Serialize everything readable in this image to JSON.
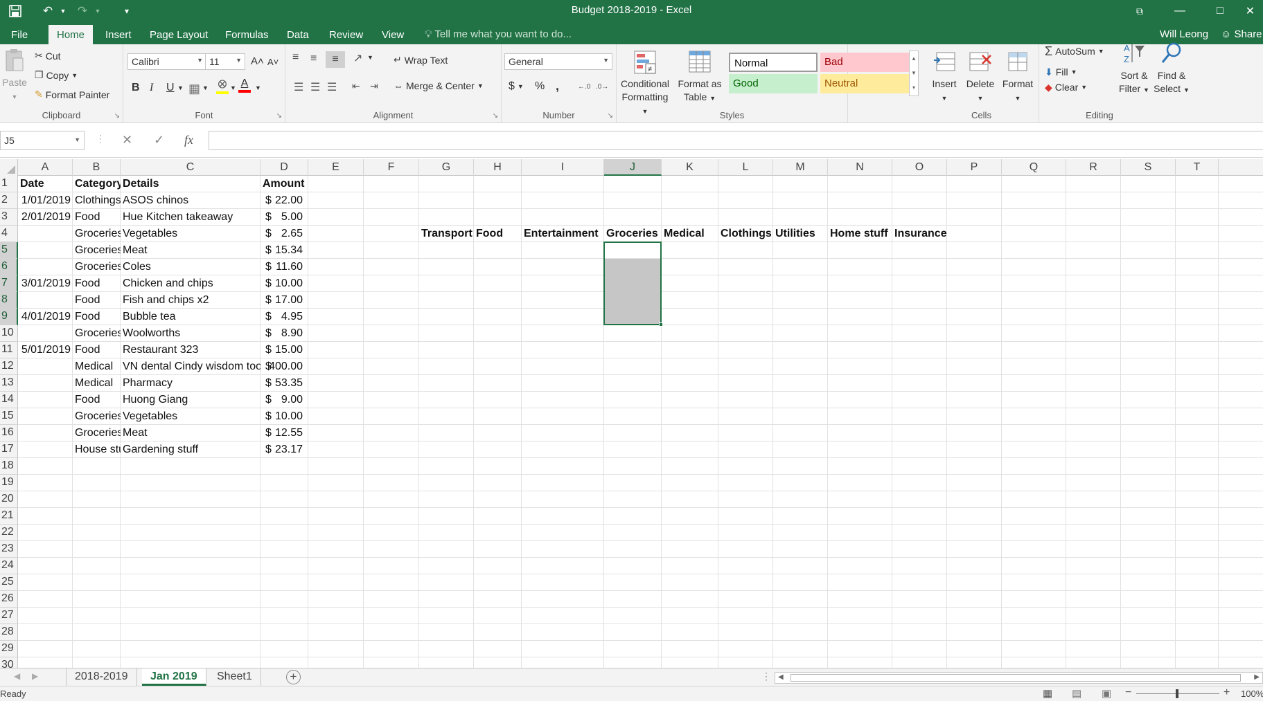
{
  "title": "Budget 2018-2019 - Excel",
  "quick_access": {
    "save_icon": "save-icon",
    "undo_icon": "undo-icon",
    "redo_icon": "redo-icon"
  },
  "tabs": [
    "File",
    "Home",
    "Insert",
    "Page Layout",
    "Formulas",
    "Data",
    "Review",
    "View"
  ],
  "active_tab": "Home",
  "tell_me": "Tell me what you want to do...",
  "user": "Will Leong",
  "share": "Share",
  "ribbon": {
    "clipboard": {
      "label": "Clipboard",
      "paste": "Paste",
      "cut": "Cut",
      "copy": "Copy",
      "format_painter": "Format Painter"
    },
    "font": {
      "label": "Font",
      "font_name": "Calibri",
      "font_size": "11",
      "bold": "B",
      "italic": "I",
      "underline": "U"
    },
    "alignment": {
      "label": "Alignment",
      "wrap_text": "Wrap Text",
      "merge_center": "Merge & Center"
    },
    "number": {
      "label": "Number",
      "format": "General",
      "currency": "$",
      "percent": "%",
      "comma": ","
    },
    "styles": {
      "label": "Styles",
      "conditional_formatting": "Conditional Formatting",
      "format_as_table": "Format as Table",
      "normal": "Normal",
      "bad": "Bad",
      "good": "Good",
      "neutral": "Neutral"
    },
    "cells": {
      "label": "Cells",
      "insert": "Insert",
      "delete": "Delete",
      "format": "Format"
    },
    "editing": {
      "label": "Editing",
      "autosum": "AutoSum",
      "fill": "Fill",
      "clear": "Clear",
      "sort_filter": "Sort & Filter",
      "find_select": "Find & Select"
    }
  },
  "name_box": "J5",
  "formula": "",
  "columns": [
    "A",
    "B",
    "C",
    "D",
    "E",
    "F",
    "G",
    "H",
    "I",
    "J",
    "K",
    "L",
    "M",
    "N",
    "O",
    "P",
    "Q",
    "R",
    "S",
    "T"
  ],
  "selected_column": "J",
  "rows": [
    "1",
    "2",
    "3",
    "4",
    "5",
    "6",
    "7",
    "8",
    "9",
    "10",
    "11",
    "12",
    "13",
    "14",
    "15",
    "16",
    "17",
    "18",
    "19",
    "20",
    "21",
    "22",
    "23",
    "24",
    "25",
    "26",
    "27",
    "28",
    "29",
    "30"
  ],
  "selected_rows": [
    "5",
    "6",
    "7",
    "8",
    "9"
  ],
  "headers": {
    "date": "Date",
    "category": "Category",
    "details": "Details",
    "amount": "Amount"
  },
  "transactions": [
    {
      "date": "1/01/2019",
      "category": "Clothings",
      "details": "ASOS chinos",
      "currency": "$",
      "amount": "22.00"
    },
    {
      "date": "2/01/2019",
      "category": "Food",
      "details": "Hue Kitchen takeaway",
      "currency": "$",
      "amount": "5.00"
    },
    {
      "date": "",
      "category": "Groceries",
      "details": "Vegetables",
      "currency": "$",
      "amount": "2.65"
    },
    {
      "date": "",
      "category": "Groceries",
      "details": "Meat",
      "currency": "$",
      "amount": "15.34"
    },
    {
      "date": "",
      "category": "Groceries",
      "details": "Coles",
      "currency": "$",
      "amount": "11.60"
    },
    {
      "date": "3/01/2019",
      "category": "Food",
      "details": "Chicken and chips",
      "currency": "$",
      "amount": "10.00"
    },
    {
      "date": "",
      "category": "Food",
      "details": "Fish and chips x2",
      "currency": "$",
      "amount": "17.00"
    },
    {
      "date": "4/01/2019",
      "category": "Food",
      "details": "Bubble tea",
      "currency": "$",
      "amount": "4.95"
    },
    {
      "date": "",
      "category": "Groceries",
      "details": "Woolworths",
      "currency": "$",
      "amount": "8.90"
    },
    {
      "date": "5/01/2019",
      "category": "Food",
      "details": "Restaurant 323",
      "currency": "$",
      "amount": "15.00"
    },
    {
      "date": "",
      "category": "Medical",
      "details": "VN dental Cindy wisdom tooth",
      "currency": "$",
      "amount": "400.00"
    },
    {
      "date": "",
      "category": "Medical",
      "details": "Pharmacy",
      "currency": "$",
      "amount": "53.35"
    },
    {
      "date": "",
      "category": "Food",
      "details": "Huong Giang",
      "currency": "$",
      "amount": "9.00"
    },
    {
      "date": "",
      "category": "Groceries",
      "details": "Vegetables",
      "currency": "$",
      "amount": "10.00"
    },
    {
      "date": "",
      "category": "Groceries",
      "details": "Meat",
      "currency": "$",
      "amount": "12.55"
    },
    {
      "date": "",
      "category": "House stuf",
      "details": "Gardening stuff",
      "currency": "$",
      "amount": "23.17"
    }
  ],
  "summary_headers": [
    "Transport",
    "Food",
    "Entertainment",
    "Groceries",
    "Medical",
    "Clothings",
    "Utilities",
    "Home stuff",
    "Insurance"
  ],
  "sheets": [
    "2018-2019",
    "Jan 2019",
    "Sheet1"
  ],
  "active_sheet": "Jan 2019",
  "status": "Ready",
  "zoom": "100%"
}
